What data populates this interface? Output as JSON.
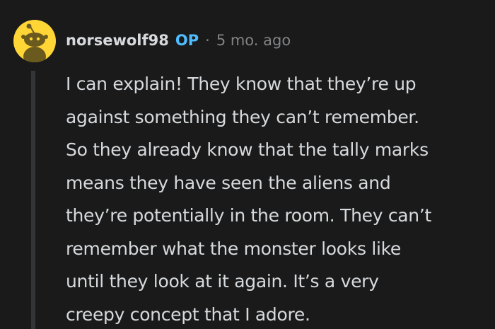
{
  "comment": {
    "username": "norsewolf98",
    "op_badge": "OP",
    "separator": "·",
    "timestamp": "5 mo. ago",
    "avatar_icon": "snoo-avatar-icon",
    "body_lines": [
      "I can explain! They know that they’re up",
      "against something they can’t remember.",
      "So they already know that the tally marks",
      "means they have seen the aliens and",
      "they’re potentially in the room. They can’t",
      "remember what the monster looks like",
      "until they look at it again. It’s a very",
      "creepy concept that I adore."
    ]
  },
  "colors": {
    "background": "#1a1a1b",
    "text": "#d7dadc",
    "op_blue": "#4fbcff",
    "muted": "#818384",
    "thread_line": "#343536",
    "avatar_bg": "#ffd635"
  }
}
